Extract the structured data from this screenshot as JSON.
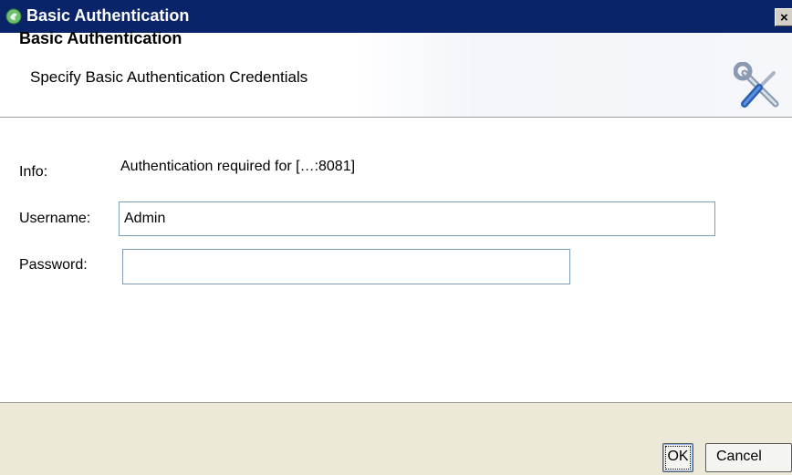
{
  "window": {
    "title": "Basic Authentication",
    "close_glyph": "×"
  },
  "header": {
    "title": "Basic Authentication",
    "subtitle": "Specify Basic Authentication Credentials",
    "icon": "tools-icon"
  },
  "form": {
    "info_label": "Info:",
    "info_value": "Authentication required for […:8081]",
    "username_label": "Username:",
    "username_value": "Admin",
    "password_label": "Password:",
    "password_value": ""
  },
  "buttons": {
    "ok": "OK",
    "cancel": "Cancel"
  },
  "colors": {
    "titlebar": "#0a246a",
    "dialog_background": "#ece9d8",
    "field_border": "#7f9db9"
  }
}
